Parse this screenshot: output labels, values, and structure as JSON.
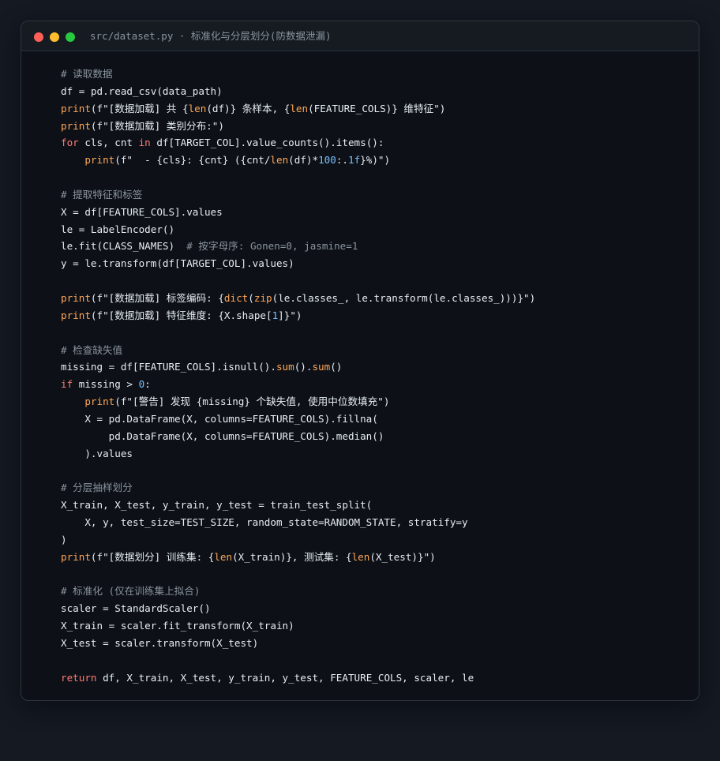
{
  "window": {
    "title": "src/dataset.py · 标准化与分层划分(防数据泄漏)"
  },
  "colors": {
    "background": "#141922",
    "editor": "#0d1117",
    "titlebar": "#161b22",
    "comment": "#8b949e",
    "keyword": "#ff7b72",
    "function": "#ffa657",
    "number": "#79c0ff",
    "text": "#e6edf3",
    "close": "#ff5f56",
    "minimize": "#ffbd2e",
    "maximize": "#27c93f"
  },
  "code_lines": [
    [
      [
        "cmt",
        "# 读取数据"
      ]
    ],
    [
      [
        "def",
        "df = pd.read_csv(data_path)"
      ]
    ],
    [
      [
        "fn",
        "print"
      ],
      [
        "def",
        "(f\"[数据加载] 共 {"
      ],
      [
        "fn",
        "len"
      ],
      [
        "def",
        "(df)} 条样本, {"
      ],
      [
        "fn",
        "len"
      ],
      [
        "def",
        "(FEATURE_COLS)} 维特征\")"
      ]
    ],
    [
      [
        "fn",
        "print"
      ],
      [
        "def",
        "(f\"[数据加载] 类别分布:\")"
      ]
    ],
    [
      [
        "kw",
        "for"
      ],
      [
        "def",
        " cls, cnt "
      ],
      [
        "kw",
        "in"
      ],
      [
        "def",
        " df[TARGET_COL].value_counts().items():"
      ]
    ],
    [
      [
        "def",
        "    "
      ],
      [
        "fn",
        "print"
      ],
      [
        "def",
        "(f\"  - {cls}: {cnt} ({cnt/"
      ],
      [
        "fn",
        "len"
      ],
      [
        "def",
        "(df)*"
      ],
      [
        "num",
        "100"
      ],
      [
        "def",
        ":."
      ],
      [
        "num",
        "1f"
      ],
      [
        "def",
        "}%)\")"
      ]
    ],
    [],
    [
      [
        "cmt",
        "# 提取特征和标签"
      ]
    ],
    [
      [
        "def",
        "X = df[FEATURE_COLS].values"
      ]
    ],
    [
      [
        "def",
        "le = LabelEncoder()"
      ]
    ],
    [
      [
        "def",
        "le.fit(CLASS_NAMES)  "
      ],
      [
        "cmt",
        "# 按字母序: Gonen=0, jasmine=1"
      ]
    ],
    [
      [
        "def",
        "y = le.transform(df[TARGET_COL].values)"
      ]
    ],
    [],
    [
      [
        "fn",
        "print"
      ],
      [
        "def",
        "(f\"[数据加载] 标签编码: {"
      ],
      [
        "fn",
        "dict"
      ],
      [
        "def",
        "("
      ],
      [
        "fn",
        "zip"
      ],
      [
        "def",
        "(le.classes_, le.transform(le.classes_)))}\")"
      ]
    ],
    [
      [
        "fn",
        "print"
      ],
      [
        "def",
        "(f\"[数据加载] 特征维度: {X.shape["
      ],
      [
        "num",
        "1"
      ],
      [
        "def",
        "]}\")"
      ]
    ],
    [],
    [
      [
        "cmt",
        "# 检查缺失值"
      ]
    ],
    [
      [
        "def",
        "missing = df[FEATURE_COLS].isnull()."
      ],
      [
        "fn",
        "sum"
      ],
      [
        "def",
        "()."
      ],
      [
        "fn",
        "sum"
      ],
      [
        "def",
        "()"
      ]
    ],
    [
      [
        "kw",
        "if"
      ],
      [
        "def",
        " missing > "
      ],
      [
        "num",
        "0"
      ],
      [
        "def",
        ":"
      ]
    ],
    [
      [
        "def",
        "    "
      ],
      [
        "fn",
        "print"
      ],
      [
        "def",
        "(f\"[警告] 发现 {missing} 个缺失值, 使用中位数填充\")"
      ]
    ],
    [
      [
        "def",
        "    X = pd.DataFrame(X, columns=FEATURE_COLS).fillna("
      ]
    ],
    [
      [
        "def",
        "        pd.DataFrame(X, columns=FEATURE_COLS).median()"
      ]
    ],
    [
      [
        "def",
        "    ).values"
      ]
    ],
    [],
    [
      [
        "cmt",
        "# 分层抽样划分"
      ]
    ],
    [
      [
        "def",
        "X_train, X_test, y_train, y_test = train_test_split("
      ]
    ],
    [
      [
        "def",
        "    X, y, test_size=TEST_SIZE, random_state=RANDOM_STATE, stratify=y"
      ]
    ],
    [
      [
        "def",
        ")"
      ]
    ],
    [
      [
        "fn",
        "print"
      ],
      [
        "def",
        "(f\"[数据划分] 训练集: {"
      ],
      [
        "fn",
        "len"
      ],
      [
        "def",
        "(X_train)}, 测试集: {"
      ],
      [
        "fn",
        "len"
      ],
      [
        "def",
        "(X_test)}\")"
      ]
    ],
    [],
    [
      [
        "cmt",
        "# 标准化 (仅在训练集上拟合)"
      ]
    ],
    [
      [
        "def",
        "scaler = StandardScaler()"
      ]
    ],
    [
      [
        "def",
        "X_train = scaler.fit_transform(X_train)"
      ]
    ],
    [
      [
        "def",
        "X_test = scaler.transform(X_test)"
      ]
    ],
    [],
    [
      [
        "kw",
        "return"
      ],
      [
        "def",
        " df, X_train, X_test, y_train, y_test, FEATURE_COLS, scaler, le"
      ]
    ]
  ]
}
